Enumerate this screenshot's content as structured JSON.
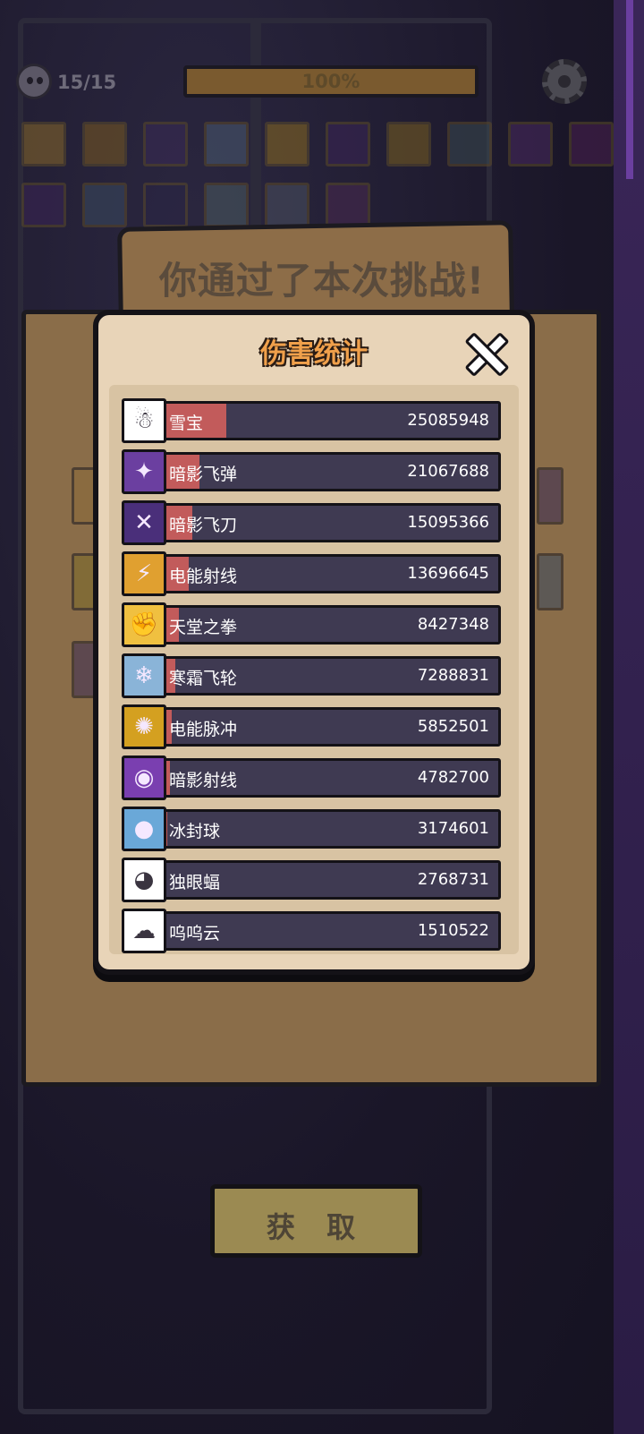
{
  "hud": {
    "kill_count": "15/15",
    "progress_text": "100%",
    "progress": 1.0
  },
  "result_banner": {
    "title": "你通过了本次挑战!"
  },
  "damage_panel": {
    "title": "伤害统计",
    "rows": [
      {
        "name": "雪宝",
        "value": "25085948",
        "icon": "snow-creature-icon",
        "icon_color": "#ffffff",
        "fill": 0.2
      },
      {
        "name": "暗影飞弹",
        "value": "21067688",
        "icon": "shadow-missile-icon",
        "icon_color": "#6b3fa0",
        "fill": 0.12
      },
      {
        "name": "暗影飞刀",
        "value": "15095366",
        "icon": "shadow-knife-icon",
        "icon_color": "#4a2f7a",
        "fill": 0.1
      },
      {
        "name": "电能射线",
        "value": "13696645",
        "icon": "electric-ray-icon",
        "icon_color": "#e0a030",
        "fill": 0.09
      },
      {
        "name": "天堂之拳",
        "value": "8427348",
        "icon": "heaven-fist-icon",
        "icon_color": "#f0c040",
        "fill": 0.06
      },
      {
        "name": "寒霜飞轮",
        "value": "7288831",
        "icon": "frost-wheel-icon",
        "icon_color": "#8ab4d8",
        "fill": 0.05
      },
      {
        "name": "电能脉冲",
        "value": "5852501",
        "icon": "electric-pulse-icon",
        "icon_color": "#d4a020",
        "fill": 0.04
      },
      {
        "name": "暗影射线",
        "value": "4782700",
        "icon": "shadow-ray-icon",
        "icon_color": "#7a3fb0",
        "fill": 0.035
      },
      {
        "name": "冰封球",
        "value": "3174601",
        "icon": "ice-orb-icon",
        "icon_color": "#6aa8d8",
        "fill": 0.025
      },
      {
        "name": "独眼蝠",
        "value": "2768731",
        "icon": "one-eyed-bat-icon",
        "icon_color": "#ffffff",
        "fill": 0.02
      },
      {
        "name": "呜呜云",
        "value": "1510522",
        "icon": "storm-cloud-icon",
        "icon_color": "#ffffff",
        "fill": 0.012
      }
    ]
  },
  "get_button": {
    "label": "获 取"
  },
  "colors": {
    "panel_bg": "#e8d4b8",
    "bar_bg": "#3f3a52",
    "bar_fill": "#c25b5b",
    "title_orange": "#f0a04b",
    "parchment": "#8a6d49"
  }
}
